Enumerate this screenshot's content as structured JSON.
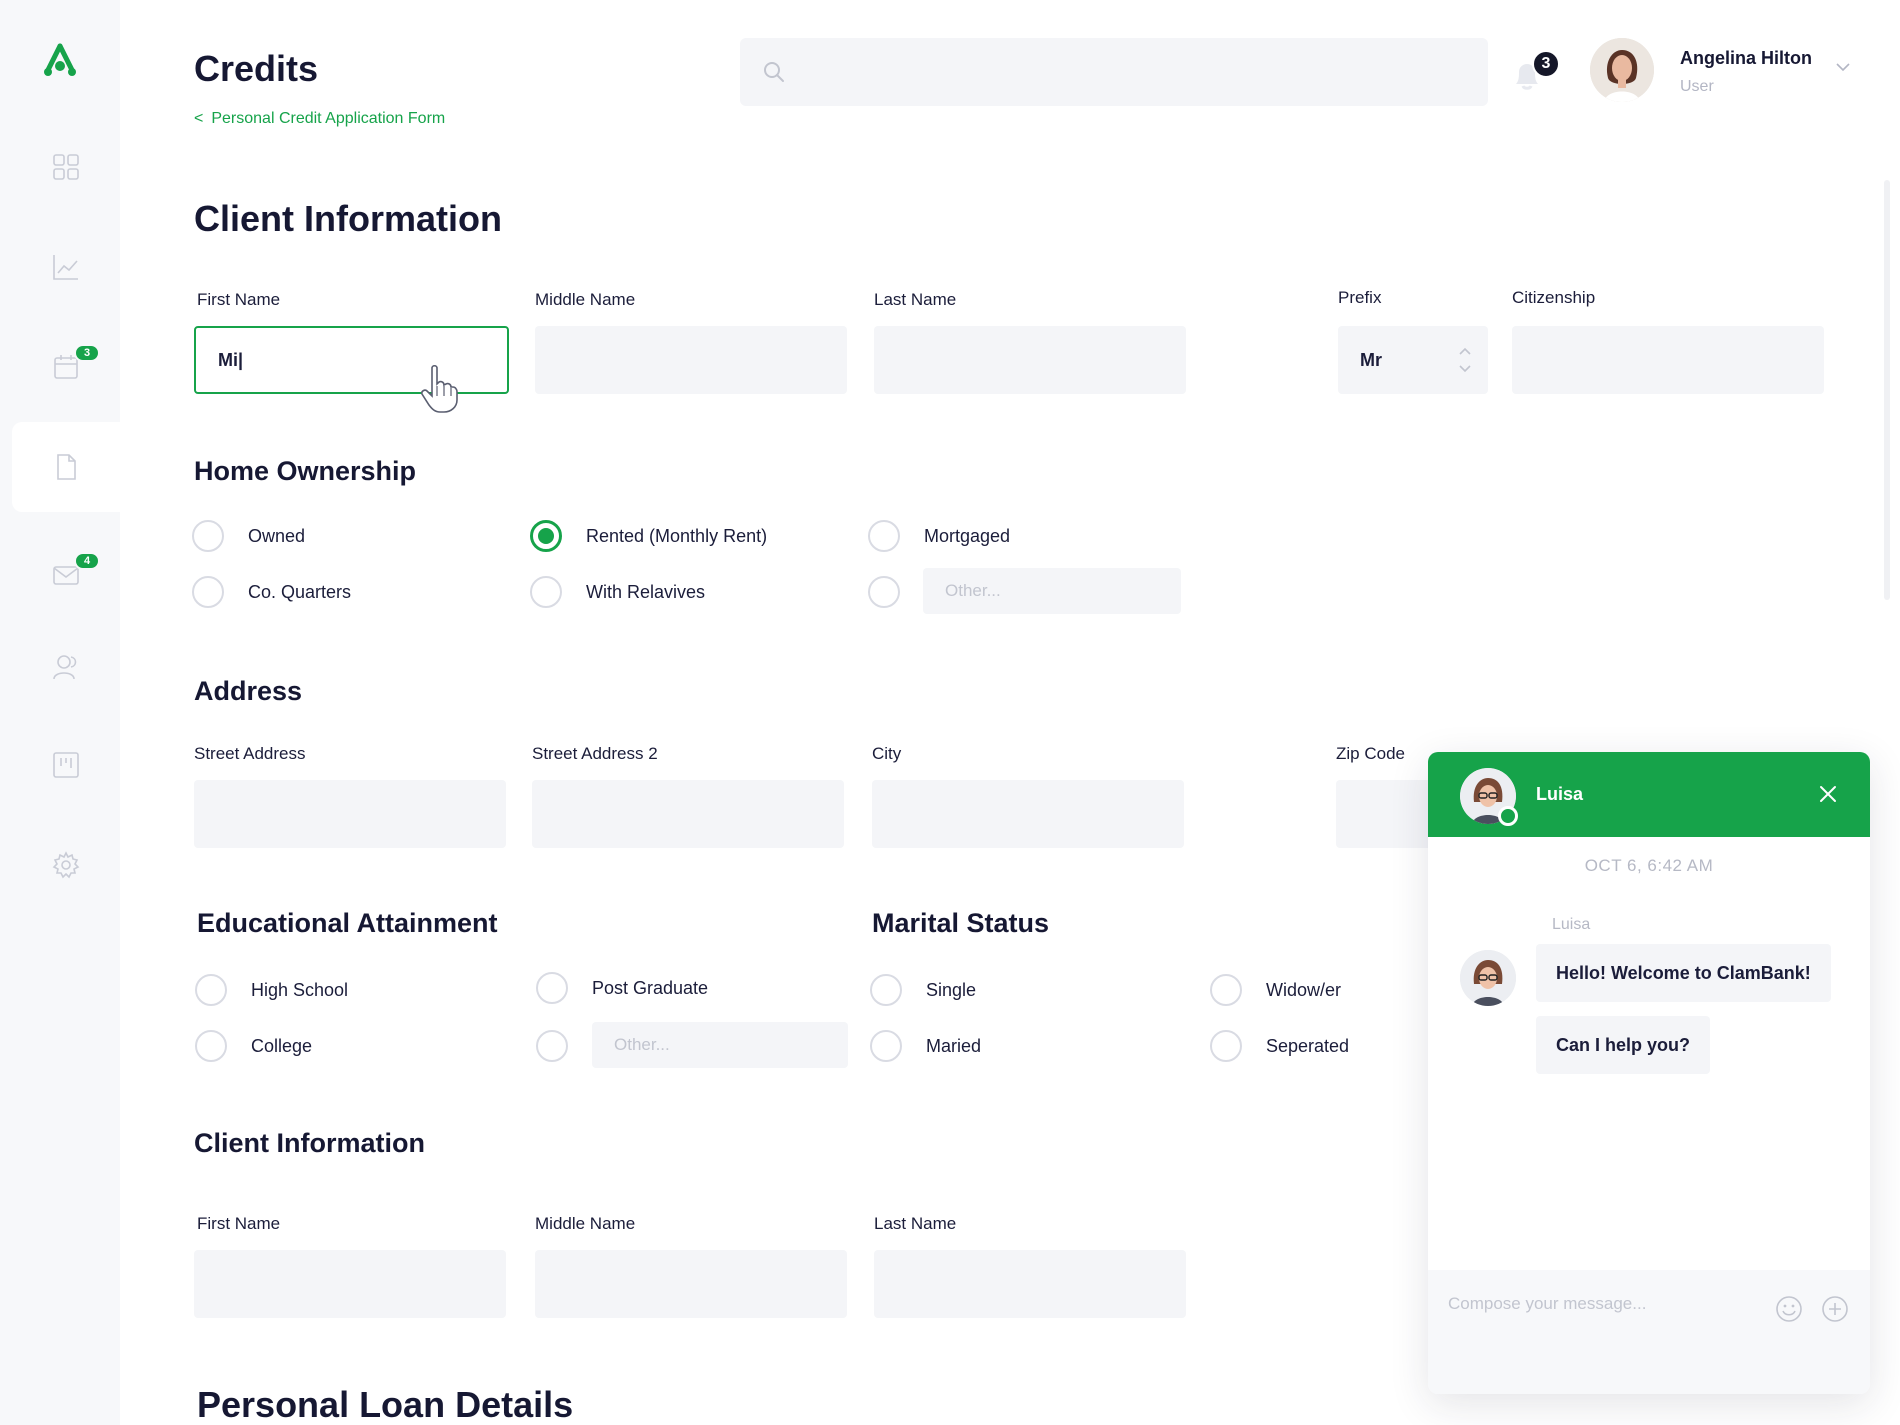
{
  "header": {
    "title": "Credits",
    "breadcrumb_arrow": "<",
    "breadcrumb_label": "Personal Credit Application Form",
    "search_placeholder": "",
    "notifications_count": "3",
    "user_name": "Angelina Hilton",
    "user_role": "User"
  },
  "sidebar": {
    "badges": {
      "calendar": "3",
      "mail": "4"
    }
  },
  "client_info": {
    "heading": "Client Information",
    "first_name_label": "First Name",
    "first_name_value": "Mi|",
    "middle_name_label": "Middle Name",
    "last_name_label": "Last Name",
    "prefix_label": "Prefix",
    "prefix_value": "Mr",
    "citizenship_label": "Citizenship"
  },
  "home_ownership": {
    "heading": "Home Ownership",
    "options": [
      "Owned",
      "Rented (Monthly Rent)",
      "Mortgaged",
      "Co. Quarters",
      "With Relavives"
    ],
    "other_placeholder": "Other..."
  },
  "address": {
    "heading": "Address",
    "street_label": "Street Address",
    "street2_label": "Street Address 2",
    "city_label": "City",
    "zip_label": "Zip Code"
  },
  "education": {
    "heading": "Educational Attainment",
    "options": [
      "High School",
      "Post Graduate",
      "College"
    ],
    "other_placeholder": "Other..."
  },
  "marital": {
    "heading": "Marital Status",
    "options": [
      "Single",
      "Widow/er",
      "Maried",
      "Seperated"
    ]
  },
  "client_info_2": {
    "heading": "Client Information",
    "first_name_label": "First Name",
    "middle_name_label": "Middle Name",
    "last_name_label": "Last Name"
  },
  "loan": {
    "heading": "Personal Loan Details"
  },
  "chat": {
    "agent_name": "Luisa",
    "date": "OCT 6, 6:42 AM",
    "sender": "Luisa",
    "messages": [
      "Hello! Welcome to ClamBank!",
      "Can I help you?"
    ],
    "compose_placeholder": "Compose your message..."
  },
  "colors": {
    "accent": "#16a34a",
    "text": "#1b1d3a",
    "field_bg": "#f4f5f8"
  }
}
